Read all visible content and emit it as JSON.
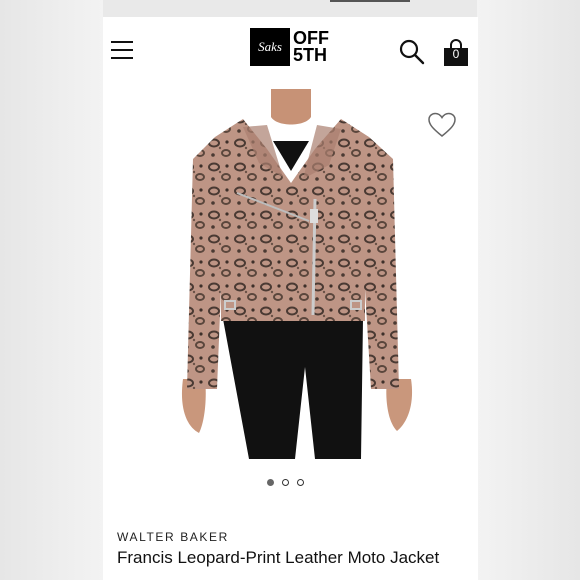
{
  "header": {
    "logo_script": "Saks",
    "logo_line1": "OFF",
    "logo_line2": "5TH",
    "bag_count": "0"
  },
  "icons": {
    "menu": "menu-icon",
    "search": "search-icon",
    "bag": "shopping-bag-icon",
    "wishlist": "heart-icon"
  },
  "carousel": {
    "total": 3,
    "active": 1
  },
  "product": {
    "brand": "WALTER BAKER",
    "title": "Francis Leopard-Print Leather Moto Jacket"
  },
  "colors": {
    "accent": "#000000",
    "jacket": "#b88d7e",
    "pants": "#111111"
  }
}
